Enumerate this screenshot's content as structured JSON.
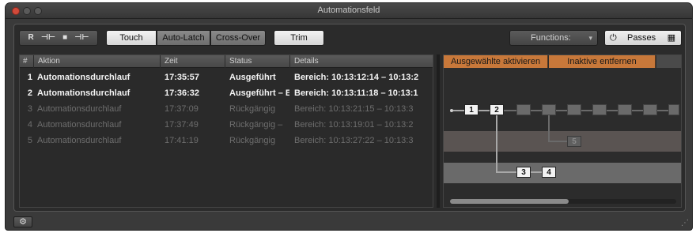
{
  "window": {
    "title": "Automationsfeld"
  },
  "toolbar": {
    "mode_icons": [
      "R",
      "⊣⊢",
      "■",
      "⊣⊢"
    ],
    "touch_label": "Touch",
    "autolatch_label": "Auto-Latch",
    "crossover_label": "Cross-Over",
    "trim_label": "Trim",
    "functions_label": "Functions:",
    "functions_caret": "▾",
    "passes_icon": "⏻",
    "passes_label": "Passes",
    "grid_icon": "▦"
  },
  "table": {
    "headers": {
      "num": "#",
      "action": "Aktion",
      "time": "Zeit",
      "status": "Status",
      "details": "Details"
    },
    "rows": [
      {
        "num": "1",
        "action": "Automationsdurchlauf",
        "time": "17:35:57",
        "status": "Ausgeführt",
        "details": "Bereich: 10:13:12:14 – 10:13:2",
        "state": "active"
      },
      {
        "num": "2",
        "action": "Automationsdurchlauf",
        "time": "17:36:32",
        "status": "Ausgeführt – E",
        "details": "Bereich: 10:13:11:18 – 10:13:1",
        "state": "active"
      },
      {
        "num": "3",
        "action": "Automationsdurchlauf",
        "time": "17:37:09",
        "status": "Rückgängig",
        "details": "Bereich: 10:13:21:15 – 10:13:3",
        "state": "undone"
      },
      {
        "num": "4",
        "action": "Automationsdurchlauf",
        "time": "17:37:49",
        "status": "Rückgängig –",
        "details": "Bereich: 10:13:19:01 – 10:13:2",
        "state": "undone"
      },
      {
        "num": "5",
        "action": "Automationsdurchlauf",
        "time": "17:41:19",
        "status": "Rückgängig",
        "details": "Bereich: 10:13:27:22 – 10:13:3",
        "state": "undone"
      }
    ]
  },
  "graph": {
    "tab_activate": "Ausgewählte aktivieren",
    "tab_remove": "Inaktive entfernen",
    "nodes": {
      "n1": "1",
      "n2": "2",
      "n3": "3",
      "n4": "4",
      "n5": "5"
    }
  },
  "footer": {
    "gear_icon": "⚙",
    "resize_icon": "⋰"
  }
}
